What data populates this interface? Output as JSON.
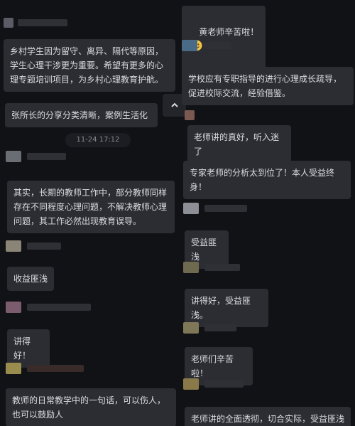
{
  "timestamp": "11-24 17:12",
  "scroll_up_icon": "chevron-up-icon",
  "emoji_icon": "smiling-face-icon",
  "colors": {
    "background": "#111216",
    "bubble": "#2c2d33",
    "text": "#dcdde1",
    "timestamp_text": "#8b8c92",
    "emoji": "#f5c542"
  },
  "left_messages": [
    {
      "text": "乡村学生因为留守、离异、隔代等原因，\n学生心理干涉更为重要。希望有更多的心\n理专题培训项目，为乡村心理教育护航。"
    },
    {
      "text": "张所长的分享分类清晰，案例生活化"
    },
    {
      "text": "其实，长期的教师工作中，部分教师同样\n存在不同程度心理问题，不解决教师心理\n问题，其工作必然出现教育误导。"
    },
    {
      "text": "收益匪浅"
    },
    {
      "text": "讲得好！"
    },
    {
      "text": "教师的日常教学中的一句话，可以伤人，\n也可以鼓励人"
    }
  ],
  "right_messages": [
    {
      "text": "黄老师辛苦啦！"
    },
    {
      "text": "学校应有专职指导的进行心理成长疏导，\n促进校际交流，经验借鉴。"
    },
    {
      "text": "老师讲的真好，听入迷了"
    },
    {
      "text": "专家老师的分析太到位了！本人受益终\n身！"
    },
    {
      "text": "受益匪浅"
    },
    {
      "text": "讲得好，受益匪浅。"
    },
    {
      "text": "老师们辛苦啦！"
    },
    {
      "text": "老师讲的全面透彻，切合实际，受益匪浅"
    }
  ]
}
